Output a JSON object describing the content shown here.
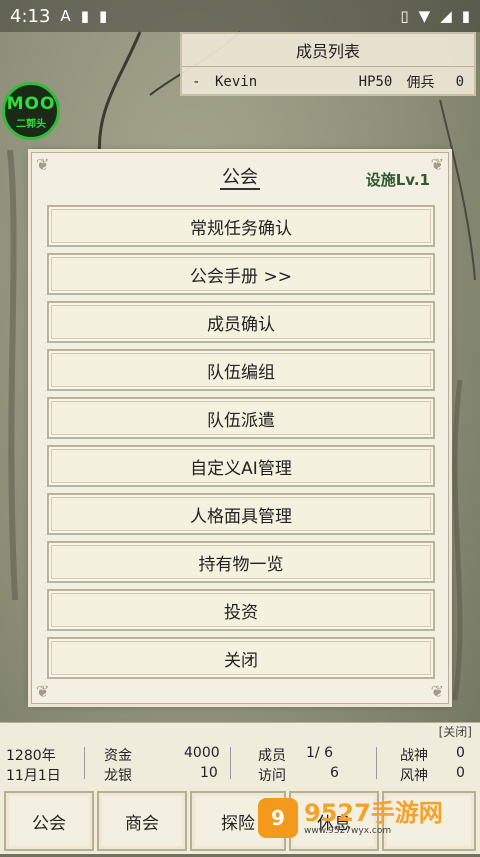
{
  "status_bar": {
    "time": "4:13",
    "left_icons": [
      "A",
      "▮",
      "▮"
    ],
    "right_icons": [
      "vibrate-icon",
      "wifi-icon",
      "signal-icon",
      "battery-icon"
    ]
  },
  "member_list": {
    "title": "成员列表",
    "rows": [
      {
        "marker": "-",
        "name": "Kevin",
        "hp": "HP50",
        "role": "佣兵",
        "count": "0"
      }
    ]
  },
  "badge": {
    "line1": "MOO",
    "line2": "二郭头"
  },
  "dialog": {
    "title": "公会",
    "level": "设施Lv.1",
    "menu": [
      "常规任务确认",
      "公会手册  >>",
      "成员确认",
      "队伍编组",
      "队伍派遣",
      "自定义AI管理",
      "人格面具管理",
      "持有物一览",
      "投资",
      "关闭"
    ]
  },
  "bottom_panel": {
    "close_label": "[关闭]",
    "year": "1280年",
    "date": "11月1日",
    "funds_label": "资金",
    "funds_value": "4000",
    "dragon_silver_label": "龙银",
    "dragon_silver_value": "10",
    "members_label": "成员",
    "members_value": "1/ 6",
    "visits_label": "访问",
    "visits_value": "6",
    "war_god_label": "战神",
    "war_god_value": "0",
    "wind_god_label": "风神",
    "wind_god_value": "0",
    "buttons": [
      "公会",
      "商会",
      "探险",
      "休息",
      ""
    ]
  },
  "watermark": {
    "logo": "9",
    "main": "9527手游网",
    "sub": "www.9527wyx.com"
  }
}
